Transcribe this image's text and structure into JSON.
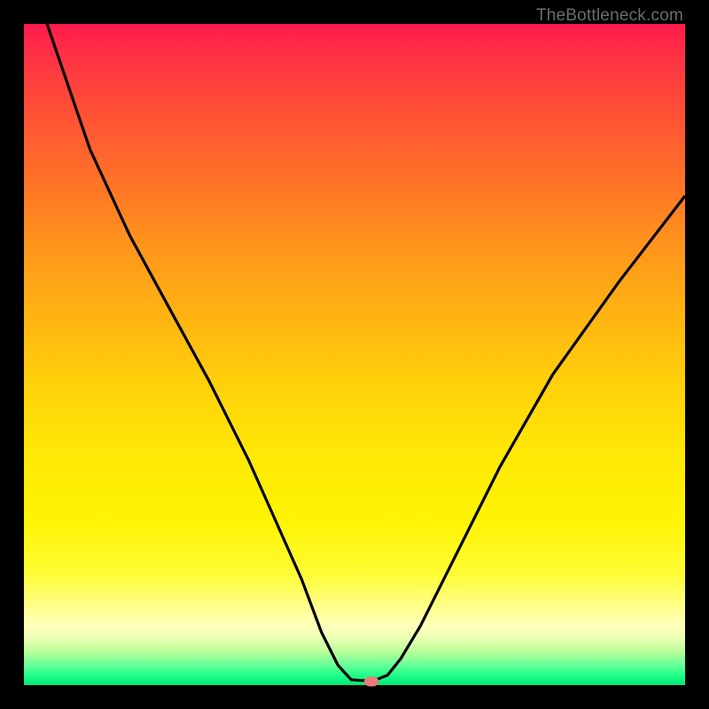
{
  "watermark": "TheBottleneck.com",
  "chart_data": {
    "type": "line",
    "title": "",
    "xlabel": "",
    "ylabel": "",
    "xlim": [
      0,
      100
    ],
    "ylim": [
      0,
      100
    ],
    "series": [
      {
        "name": "curve",
        "x": [
          3.5,
          10,
          16,
          22,
          28,
          34,
          38,
          42,
          45,
          47.5,
          49.5,
          51,
          53,
          55,
          57,
          60,
          65,
          72,
          80,
          90,
          100
        ],
        "y": [
          100,
          81,
          68,
          57,
          46,
          34,
          25,
          16,
          8,
          3,
          0.8,
          0.7,
          0.7,
          1.5,
          4,
          9,
          19,
          33,
          47,
          61,
          74
        ],
        "note": "y is percent from bottom (0=bottom green, 100=top red). Curve reaches minimum near x≈52."
      }
    ],
    "marker": {
      "x": 52.5,
      "y": 0.6
    },
    "colors": {
      "background_top": "#ff1a4d",
      "background_bottom": "#00e97a",
      "curve": "#000000",
      "marker": "#e97a7a",
      "frame": "#000000"
    }
  }
}
